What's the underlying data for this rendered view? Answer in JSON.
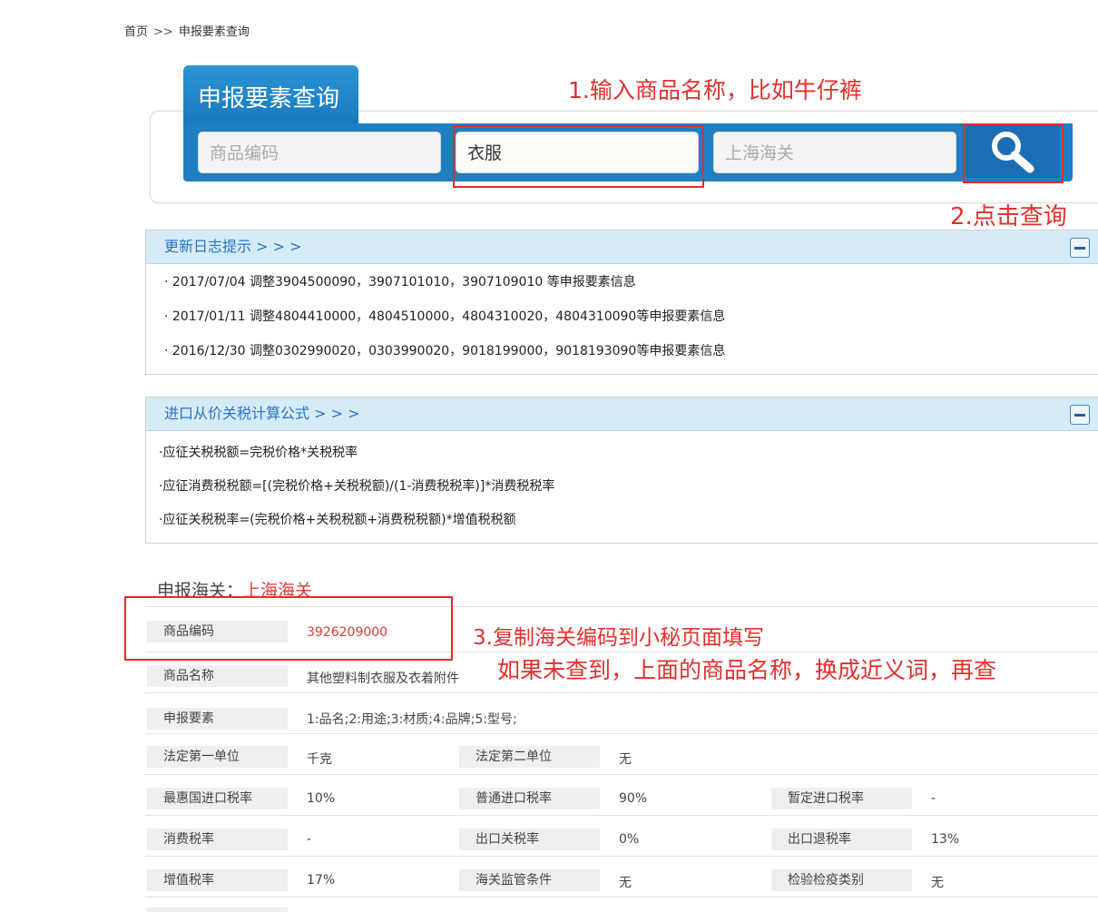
{
  "breadcrumb": {
    "home": "首页",
    "sep": ">>",
    "current": "申报要素查询"
  },
  "search": {
    "tab_title": "申报要素查询",
    "code_placeholder": "商品编码",
    "name_value": "衣服",
    "customs_placeholder": "上海海关",
    "button_icon": "search-icon"
  },
  "annotations": {
    "step1": "1.输入商品名称，比如牛仔裤",
    "step2": "2.点击查询",
    "step3_line1": "3.复制海关编码到小秘页面填写",
    "step3_line2": "如果未查到，上面的商品名称，换成近义词，再查"
  },
  "update_log": {
    "title": "更新日志提示 > > >",
    "items": [
      "· 2017/07/04 调整3904500090，3907101010，3907109010 等申报要素信息",
      "· 2017/01/11 调整4804410000，4804510000，4804310020，4804310090等申报要素信息",
      "· 2016/12/30 调整0302990020，0303990020，9018199000，9018193090等申报要素信息"
    ]
  },
  "formula": {
    "title": "进口从价关税计算公式 > > >",
    "items": [
      "·应征关税税额=完税价格*关税税率",
      "·应征消费税税额=[(完税价格+关税税额)/(1-消费税税率)]*消费税税率",
      "·应征关税税率=(完税价格+关税税额+消费税税额)*增值税税额"
    ]
  },
  "result": {
    "customs_label": "申报海关：",
    "customs_value": "上海海关",
    "code_label": "商品编码",
    "code_value": "3926209000",
    "name_label": "商品名称",
    "name_value": "其他塑料制衣服及衣着附件",
    "elements_label": "申报要素",
    "elements_value": "1:品名;2:用途;3:材质;4:品牌;5:型号;",
    "grid": [
      [
        {
          "label": "法定第一单位",
          "value": "千克"
        },
        {
          "label": "法定第二单位",
          "value": "无"
        }
      ],
      [
        {
          "label": "最惠国进口税率",
          "value": "10%"
        },
        {
          "label": "普通进口税率",
          "value": "90%"
        },
        {
          "label": "暂定进口税率",
          "value": "-"
        }
      ],
      [
        {
          "label": "消费税率",
          "value": "-"
        },
        {
          "label": "出口关税率",
          "value": "0%"
        },
        {
          "label": "出口退税率",
          "value": "13%"
        }
      ],
      [
        {
          "label": "增值税率",
          "value": "17%"
        },
        {
          "label": "海关监管条件",
          "value": "无"
        },
        {
          "label": "检验检疫类别",
          "value": "无"
        }
      ]
    ]
  }
}
